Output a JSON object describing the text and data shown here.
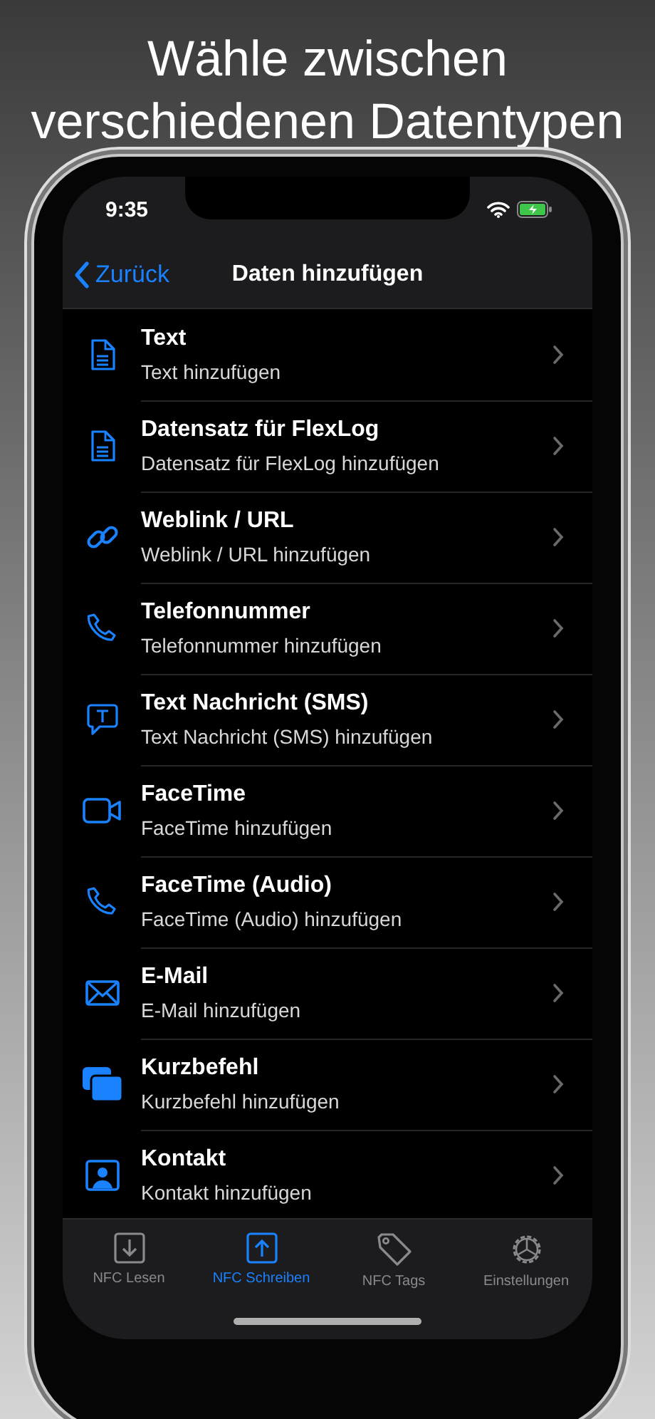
{
  "headline": [
    "Wähle zwischen",
    "verschiedenen Datentypen"
  ],
  "status_bar": {
    "time": "9:35"
  },
  "nav": {
    "back": "Zurück",
    "title": "Daten hinzufügen"
  },
  "items": [
    {
      "kind": "document",
      "title": "Text",
      "subtitle": "Text hinzufügen"
    },
    {
      "kind": "document",
      "title": "Datensatz für FlexLog",
      "subtitle": "Datensatz für FlexLog hinzufügen"
    },
    {
      "kind": "link",
      "title": "Weblink / URL",
      "subtitle": "Weblink / URL hinzufügen"
    },
    {
      "kind": "phone",
      "title": "Telefonnummer",
      "subtitle": "Telefonnummer hinzufügen"
    },
    {
      "kind": "message",
      "title": "Text Nachricht (SMS)",
      "subtitle": "Text Nachricht (SMS) hinzufügen"
    },
    {
      "kind": "video",
      "title": "FaceTime",
      "subtitle": "FaceTime hinzufügen"
    },
    {
      "kind": "phone",
      "title": "FaceTime (Audio)",
      "subtitle": "FaceTime (Audio) hinzufügen"
    },
    {
      "kind": "mail",
      "title": "E-Mail",
      "subtitle": "E-Mail hinzufügen"
    },
    {
      "kind": "shortcut",
      "title": "Kurzbefehl",
      "subtitle": "Kurzbefehl hinzufügen"
    },
    {
      "kind": "contact",
      "title": "Kontakt",
      "subtitle": "Kontakt hinzufügen"
    }
  ],
  "tabs": [
    {
      "kind": "read",
      "label": "NFC Lesen",
      "selected": false
    },
    {
      "kind": "write",
      "label": "NFC Schreiben",
      "selected": true
    },
    {
      "kind": "tag",
      "label": "NFC Tags",
      "selected": false
    },
    {
      "kind": "settings",
      "label": "Einstellungen",
      "selected": false
    }
  ]
}
